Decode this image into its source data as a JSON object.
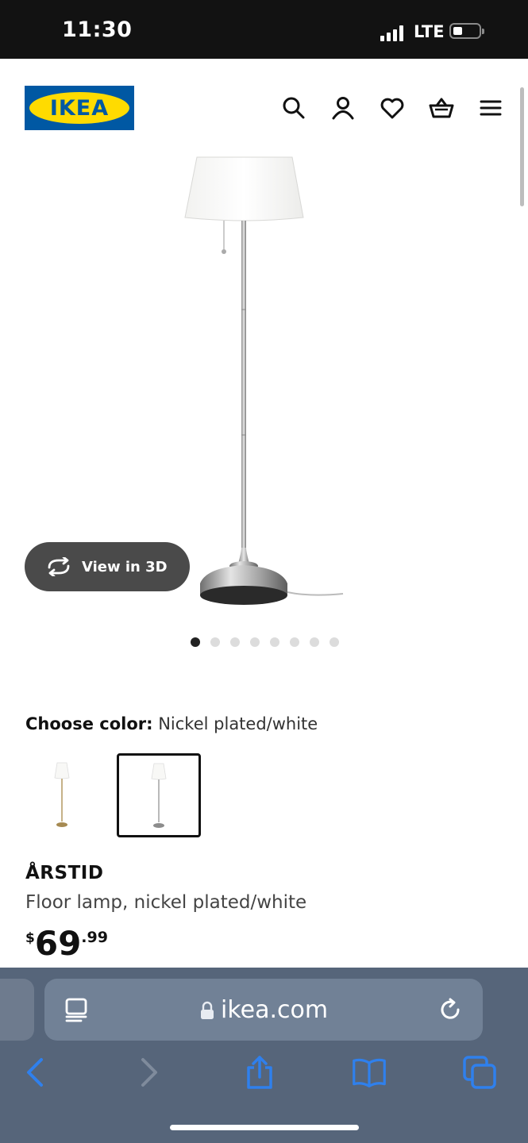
{
  "status_bar": {
    "time": "11:30",
    "network": "LTE"
  },
  "header": {
    "logo_text": "IKEA",
    "icons": [
      "search-icon",
      "account-icon",
      "heart-icon",
      "basket-icon",
      "menu-icon"
    ]
  },
  "gallery": {
    "view_3d_label": "View in 3D",
    "image_count": 8,
    "active_index": 0
  },
  "color_picker": {
    "label": "Choose color:",
    "selected_value": "Nickel plated/white",
    "swatches": [
      {
        "variant": "brass",
        "selected": false
      },
      {
        "variant": "nickel",
        "selected": true
      }
    ]
  },
  "product": {
    "name": "ÅRSTID",
    "description": "Floor lamp, nickel plated/white",
    "price": {
      "currency": "$",
      "integer": "69",
      "decimal": ".99"
    }
  },
  "browser": {
    "url": "ikea.com",
    "toolbar": [
      "back-icon",
      "forward-icon",
      "share-icon",
      "bookmarks-icon",
      "tabs-icon"
    ]
  },
  "colors": {
    "ikea_blue": "#0058a3",
    "ikea_yellow": "#ffdb00",
    "safari_blue": "#2f80ed",
    "browser_bg": "#56657a"
  }
}
